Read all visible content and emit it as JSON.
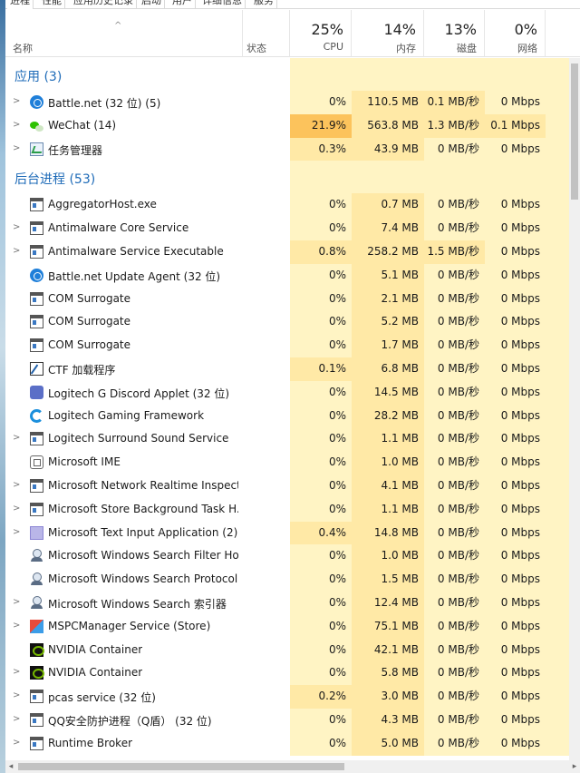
{
  "tabs": [
    "进程",
    "性能",
    "应用历史记录",
    "启动",
    "用户",
    "详细信息",
    "服务"
  ],
  "header": {
    "name_label": "名称",
    "status_label": "状态",
    "cpu": {
      "pct": "25%",
      "label": "CPU"
    },
    "memory": {
      "pct": "14%",
      "label": "内存"
    },
    "disk": {
      "pct": "13%",
      "label": "磁盘"
    },
    "network": {
      "pct": "0%",
      "label": "网络"
    }
  },
  "groups": {
    "apps": "应用 (3)",
    "background": "后台进程 (53)"
  },
  "apps": [
    {
      "name": "Battle.net (32 位) (5)",
      "icon": "battlenet-icon",
      "cpu": "0%",
      "mem": "110.5 MB",
      "disk": "0.1 MB/秒",
      "net": "0 Mbps"
    },
    {
      "name": "WeChat (14)",
      "icon": "wechat-icon",
      "cpu": "21.9%",
      "mem": "563.8 MB",
      "disk": "1.3 MB/秒",
      "net": "0.1 Mbps"
    },
    {
      "name": "任务管理器",
      "icon": "task-manager-icon",
      "cpu": "0.3%",
      "mem": "43.9 MB",
      "disk": "0 MB/秒",
      "net": "0 Mbps"
    }
  ],
  "background": [
    {
      "name": "AggregatorHost.exe",
      "icon": "window-icon",
      "cpu": "0%",
      "mem": "0.7 MB",
      "disk": "0 MB/秒",
      "net": "0 Mbps",
      "expand": false
    },
    {
      "name": "Antimalware Core Service",
      "icon": "window-icon",
      "cpu": "0%",
      "mem": "7.4 MB",
      "disk": "0 MB/秒",
      "net": "0 Mbps",
      "expand": true
    },
    {
      "name": "Antimalware Service Executable",
      "icon": "window-icon",
      "cpu": "0.8%",
      "mem": "258.2 MB",
      "disk": "1.5 MB/秒",
      "net": "0 Mbps",
      "expand": true
    },
    {
      "name": "Battle.net Update Agent (32 位)",
      "icon": "battlenet-icon",
      "cpu": "0%",
      "mem": "5.1 MB",
      "disk": "0 MB/秒",
      "net": "0 Mbps",
      "expand": false
    },
    {
      "name": "COM Surrogate",
      "icon": "window-icon",
      "cpu": "0%",
      "mem": "2.1 MB",
      "disk": "0 MB/秒",
      "net": "0 Mbps",
      "expand": false
    },
    {
      "name": "COM Surrogate",
      "icon": "window-icon",
      "cpu": "0%",
      "mem": "5.2 MB",
      "disk": "0 MB/秒",
      "net": "0 Mbps",
      "expand": false
    },
    {
      "name": "COM Surrogate",
      "icon": "window-icon",
      "cpu": "0%",
      "mem": "1.7 MB",
      "disk": "0 MB/秒",
      "net": "0 Mbps",
      "expand": false
    },
    {
      "name": "CTF 加载程序",
      "icon": "ctf-icon",
      "cpu": "0.1%",
      "mem": "6.8 MB",
      "disk": "0 MB/秒",
      "net": "0 Mbps",
      "expand": false
    },
    {
      "name": "Logitech G Discord Applet (32 位)",
      "icon": "logitech-discord-icon",
      "cpu": "0%",
      "mem": "14.5 MB",
      "disk": "0 MB/秒",
      "net": "0 Mbps",
      "expand": false
    },
    {
      "name": "Logitech Gaming Framework",
      "icon": "logitech-g-icon",
      "cpu": "0%",
      "mem": "28.2 MB",
      "disk": "0 MB/秒",
      "net": "0 Mbps",
      "expand": false
    },
    {
      "name": "Logitech Surround Sound Service",
      "icon": "window-icon",
      "cpu": "0%",
      "mem": "1.1 MB",
      "disk": "0 MB/秒",
      "net": "0 Mbps",
      "expand": true
    },
    {
      "name": "Microsoft IME",
      "icon": "ime-icon",
      "cpu": "0%",
      "mem": "1.0 MB",
      "disk": "0 MB/秒",
      "net": "0 Mbps",
      "expand": false
    },
    {
      "name": "Microsoft Network Realtime Inspecti...",
      "icon": "window-icon",
      "cpu": "0%",
      "mem": "4.1 MB",
      "disk": "0 MB/秒",
      "net": "0 Mbps",
      "expand": true
    },
    {
      "name": "Microsoft Store Background Task H...",
      "icon": "window-icon",
      "cpu": "0%",
      "mem": "1.1 MB",
      "disk": "0 MB/秒",
      "net": "0 Mbps",
      "expand": true
    },
    {
      "name": "Microsoft Text Input Application (2)",
      "icon": "text-input-icon",
      "cpu": "0.4%",
      "mem": "14.8 MB",
      "disk": "0 MB/秒",
      "net": "0 Mbps",
      "expand": true
    },
    {
      "name": "Microsoft Windows Search Filter Host",
      "icon": "search-indexer-icon",
      "cpu": "0%",
      "mem": "1.0 MB",
      "disk": "0 MB/秒",
      "net": "0 Mbps",
      "expand": false
    },
    {
      "name": "Microsoft Windows Search Protocol ...",
      "icon": "search-indexer-icon",
      "cpu": "0%",
      "mem": "1.5 MB",
      "disk": "0 MB/秒",
      "net": "0 Mbps",
      "expand": false
    },
    {
      "name": "Microsoft Windows Search 索引器",
      "icon": "search-indexer-icon",
      "cpu": "0%",
      "mem": "12.4 MB",
      "disk": "0 MB/秒",
      "net": "0 Mbps",
      "expand": true
    },
    {
      "name": "MSPCManager Service (Store)",
      "icon": "pc-manager-icon",
      "cpu": "0%",
      "mem": "75.1 MB",
      "disk": "0 MB/秒",
      "net": "0 Mbps",
      "expand": true
    },
    {
      "name": "NVIDIA Container",
      "icon": "nvidia-icon",
      "cpu": "0%",
      "mem": "42.1 MB",
      "disk": "0 MB/秒",
      "net": "0 Mbps",
      "expand": false
    },
    {
      "name": "NVIDIA Container",
      "icon": "nvidia-icon",
      "cpu": "0%",
      "mem": "5.8 MB",
      "disk": "0 MB/秒",
      "net": "0 Mbps",
      "expand": true
    },
    {
      "name": "pcas service (32 位)",
      "icon": "window-icon",
      "cpu": "0.2%",
      "mem": "3.0 MB",
      "disk": "0 MB/秒",
      "net": "0 Mbps",
      "expand": true
    },
    {
      "name": "QQ安全防护进程（Q盾） (32 位)",
      "icon": "window-icon",
      "cpu": "0%",
      "mem": "4.3 MB",
      "disk": "0 MB/秒",
      "net": "0 Mbps",
      "expand": true
    },
    {
      "name": "Runtime Broker",
      "icon": "window-icon",
      "cpu": "0%",
      "mem": "5.0 MB",
      "disk": "0 MB/秒",
      "net": "0 Mbps",
      "expand": true
    }
  ],
  "colors": {
    "group_text": "#1e6bb8",
    "heat_light": "#fff4c4",
    "heat_mid": "#ffe9a6",
    "heat_hot": "#fcc35c"
  }
}
